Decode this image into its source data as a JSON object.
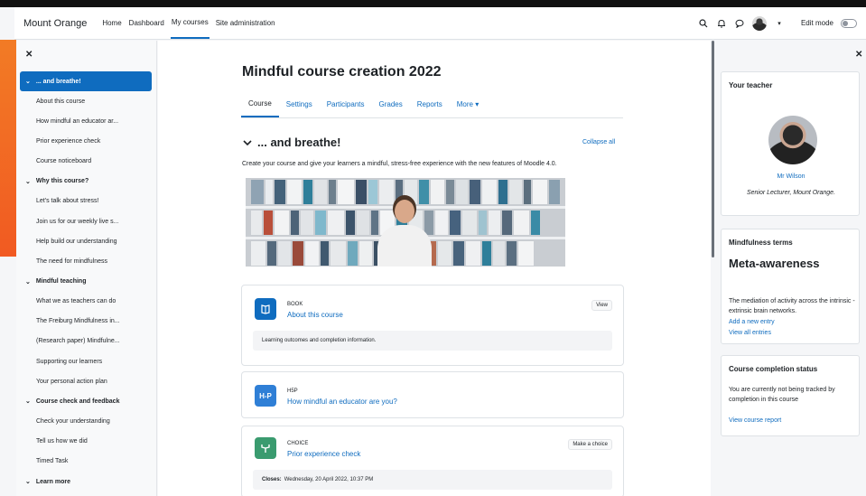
{
  "navbar": {
    "brand": "Mount Orange",
    "links": [
      "Home",
      "Dashboard",
      "My courses",
      "Site administration"
    ],
    "active_link": "My courses",
    "edit_mode_label": "Edit mode"
  },
  "course_index": {
    "items": [
      {
        "kind": "section",
        "label": "... and breathe!",
        "active": true
      },
      {
        "kind": "item",
        "label": "About this course"
      },
      {
        "kind": "item",
        "label": "How mindful an educator ar..."
      },
      {
        "kind": "item",
        "label": "Prior experience check"
      },
      {
        "kind": "item",
        "label": "Course noticeboard"
      },
      {
        "kind": "section",
        "label": "Why this course?"
      },
      {
        "kind": "item",
        "label": "Let's talk about stress!"
      },
      {
        "kind": "item",
        "label": "Join us for our weekly live s..."
      },
      {
        "kind": "item",
        "label": "Help build our understanding"
      },
      {
        "kind": "item",
        "label": "The need for mindfulness"
      },
      {
        "kind": "section",
        "label": "Mindful teaching"
      },
      {
        "kind": "item",
        "label": "What we as teachers can do"
      },
      {
        "kind": "item",
        "label": "The Freiburg Mindfulness in..."
      },
      {
        "kind": "item",
        "label": "(Research paper) Mindfulne..."
      },
      {
        "kind": "item",
        "label": "Supporting our learners"
      },
      {
        "kind": "item",
        "label": "Your personal action plan"
      },
      {
        "kind": "section",
        "label": "Course check and feedback"
      },
      {
        "kind": "item",
        "label": "Check your understanding"
      },
      {
        "kind": "item",
        "label": "Tell us how we did"
      },
      {
        "kind": "item",
        "label": "Timed Task"
      },
      {
        "kind": "section",
        "label": "Learn more"
      }
    ]
  },
  "course": {
    "title": "Mindful course creation 2022",
    "tabs": [
      "Course",
      "Settings",
      "Participants",
      "Grades",
      "Reports",
      "More ▾"
    ],
    "active_tab": "Course",
    "section_title": "... and breathe!",
    "collapse_all": "Collapse all",
    "section_description": "Create your course and give your learners a mindful, stress-free experience with the new features of Moodle 4.0."
  },
  "activities": [
    {
      "icon_label": "🕮",
      "icon_color": "#0f6cbf",
      "type": "Book",
      "name": "About this course",
      "button": "View",
      "info": "Learning outcomes and completion information."
    },
    {
      "icon_label": "H-P",
      "icon_color": "#2f7fd6",
      "type": "H5P",
      "name": "How mindful an educator are you?",
      "button": "",
      "info": ""
    },
    {
      "icon_label": "⑂",
      "icon_color": "#3a9b6f",
      "type": "Choice",
      "name": "Prior experience check",
      "button": "Make a choice",
      "info_label": "Closes:",
      "info": "Wednesday, 20 April 2022, 10:37 PM"
    }
  ],
  "blocks": {
    "teacher": {
      "title": "Your teacher",
      "name": "Mr Wilson",
      "role": "Senior Lecturer, Mount Orange."
    },
    "terms": {
      "title": "Mindfulness terms",
      "term": "Meta-awareness",
      "definition": "The mediation of activity across the intrinsic -extrinsic brain networks.",
      "add": "Add a new entry",
      "view": "View all entries"
    },
    "completion": {
      "title": "Course completion status",
      "text": "You are currently not being tracked by completion in this course",
      "link": "View course report"
    }
  },
  "colors": {
    "accent": "#0f6cbf",
    "brand_orange": "#f15a22"
  }
}
